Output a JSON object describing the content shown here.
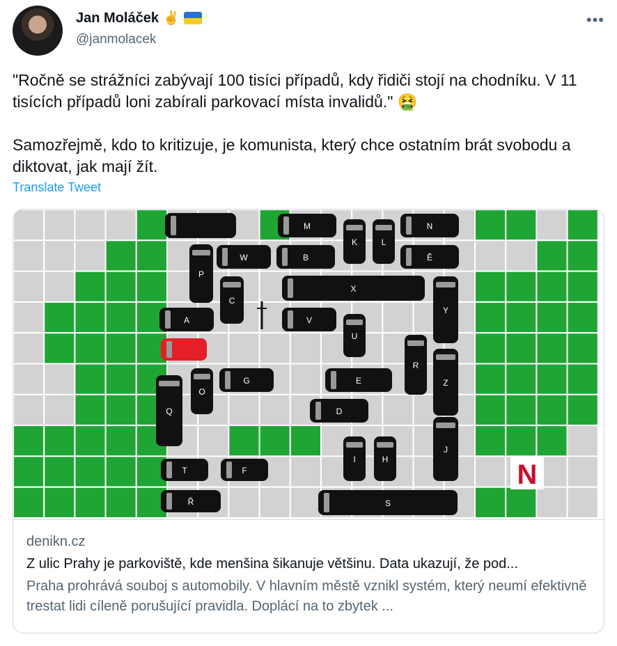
{
  "author": {
    "name": "Jan Moláček",
    "handle": "@janmolacek",
    "badges": [
      "victory-hand-emoji",
      "ukraine-flag"
    ]
  },
  "tweet": {
    "paragraph1": "\"Ročně se strážníci zabývají 100 tisíci případů, kdy řidiči stojí na chodníku. V 11 tisících případů loni zabírali parkovací místa invalidů.\"",
    "emoji1": "🤮",
    "paragraph2": "Samozřejmě, kdo to kritizuje, je komunista, který chce ostatním brát svobodu a diktovat, jak mají žít.",
    "translate_label": "Translate Tweet"
  },
  "more_label": "•••",
  "card": {
    "domain": "denikn.cz",
    "title": "Z ulic Prahy je parkoviště, kde menšina šikanuje většinu. Data ukazují, že pod...",
    "description": "Praha prohrává souboj s automobily. V hlavním městě vznikl systém, který neumí efektivně trestat lidi cíleně porušující pravidla. Doplácí na to zbytek ...",
    "image": {
      "logo_letter": "N",
      "colors": {
        "green": "#1fa534",
        "gray": "#d2d2d2",
        "grid_line": "#ffffff",
        "car": "#111111",
        "red_car": "#e41f26",
        "logo": "#c8102e"
      },
      "vehicles": [
        {
          "label": ""
        },
        {
          "label": "M"
        },
        {
          "label": "N"
        },
        {
          "label": "K"
        },
        {
          "label": "L"
        },
        {
          "label": "W"
        },
        {
          "label": "B"
        },
        {
          "label": "Ě"
        },
        {
          "label": "P"
        },
        {
          "label": "X"
        },
        {
          "label": "C"
        },
        {
          "label": "A"
        },
        {
          "label": "V"
        },
        {
          "label": "Y"
        },
        {
          "label": "U"
        },
        {
          "label": ""
        },
        {
          "label": "R"
        },
        {
          "label": "G"
        },
        {
          "label": "E"
        },
        {
          "label": "O"
        },
        {
          "label": "Q"
        },
        {
          "label": "Z"
        },
        {
          "label": "D"
        },
        {
          "label": "I"
        },
        {
          "label": "H"
        },
        {
          "label": "J"
        },
        {
          "label": "T"
        },
        {
          "label": "F"
        },
        {
          "label": "Ř"
        },
        {
          "label": "S"
        }
      ]
    }
  }
}
